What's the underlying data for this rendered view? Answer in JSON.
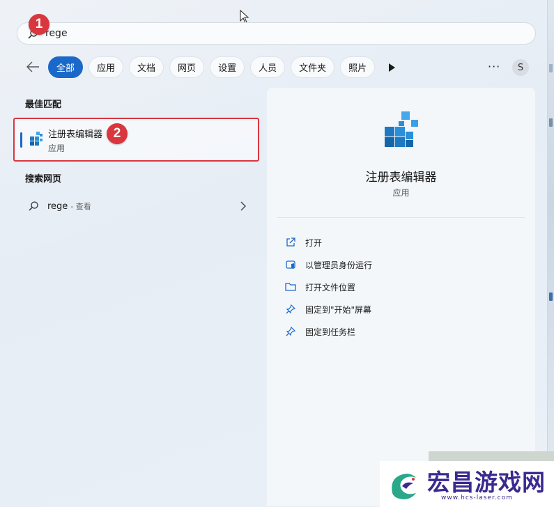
{
  "search": {
    "query": "rege"
  },
  "badges": {
    "first": "1",
    "second": "2"
  },
  "tabs": [
    {
      "label": "全部",
      "active": true
    },
    {
      "label": "应用",
      "active": false
    },
    {
      "label": "文档",
      "active": false
    },
    {
      "label": "网页",
      "active": false
    },
    {
      "label": "设置",
      "active": false
    },
    {
      "label": "人员",
      "active": false
    },
    {
      "label": "文件夹",
      "active": false
    },
    {
      "label": "照片",
      "active": false
    }
  ],
  "toolbar": {
    "more_label": "···",
    "avatar_letter": "S"
  },
  "best_match": {
    "title": "最佳匹配",
    "name": "注册表编辑器",
    "type": "应用"
  },
  "web_search": {
    "title": "搜索网页",
    "query": "rege",
    "hint": "- 查看"
  },
  "detail": {
    "name": "注册表编辑器",
    "type": "应用",
    "actions": [
      {
        "label": "打开",
        "icon": "open-external-icon"
      },
      {
        "label": "以管理员身份运行",
        "icon": "admin-shield-icon"
      },
      {
        "label": "打开文件位置",
        "icon": "folder-icon"
      },
      {
        "label": "固定到\"开始\"屏幕",
        "icon": "pin-icon"
      },
      {
        "label": "固定到任务栏",
        "icon": "pin-icon"
      }
    ]
  },
  "watermark": {
    "title": "宏昌游戏网",
    "url": "www.hcs-laser.com"
  },
  "colors": {
    "accent": "#1a68c9",
    "annotation": "#d9363e"
  }
}
